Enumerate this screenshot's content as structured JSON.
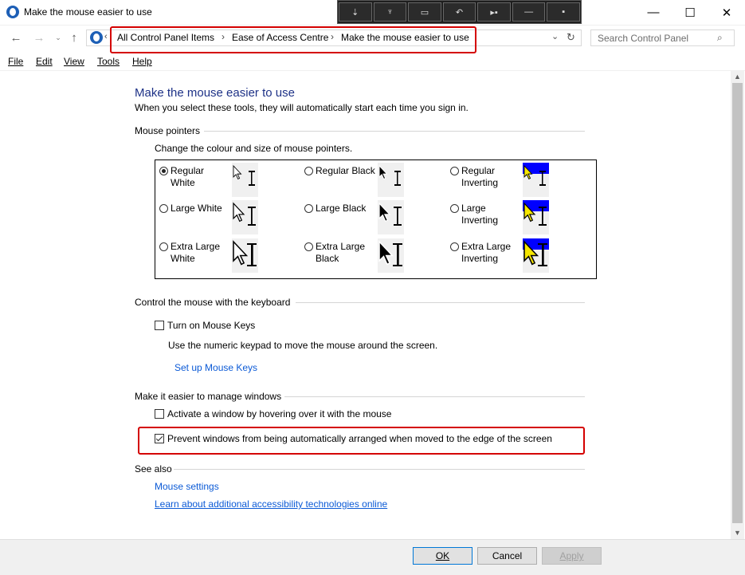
{
  "window": {
    "title": "Make the mouse easier to use",
    "minimize": "—",
    "maximize": "☐",
    "close": "✕"
  },
  "address": {
    "crumbs": [
      "All Control Panel Items",
      "Ease of Access Centre",
      "Make the mouse easier to use"
    ],
    "separator": "›",
    "search_placeholder": "Search Control Panel"
  },
  "menu": {
    "file": "File",
    "edit": "Edit",
    "view": "View",
    "tools": "Tools",
    "help": "Help"
  },
  "page": {
    "title": "Make the mouse easier to use",
    "subtitle": "When you select these tools, they will automatically start each time you sign in."
  },
  "pointers": {
    "section": "Mouse pointers",
    "caption": "Change the colour and size of mouse pointers.",
    "options": [
      {
        "line1": "Regular",
        "line2": "White",
        "selected": true,
        "scheme": "white",
        "size": 1
      },
      {
        "line1": "Regular Black",
        "line2": "",
        "selected": false,
        "scheme": "black",
        "size": 1
      },
      {
        "line1": "Regular",
        "line2": "Inverting",
        "selected": false,
        "scheme": "invert",
        "size": 1
      },
      {
        "line1": "Large White",
        "line2": "",
        "selected": false,
        "scheme": "white",
        "size": 2
      },
      {
        "line1": "Large Black",
        "line2": "",
        "selected": false,
        "scheme": "black",
        "size": 2
      },
      {
        "line1": "Large",
        "line2": "Inverting",
        "selected": false,
        "scheme": "invert",
        "size": 2
      },
      {
        "line1": "Extra Large",
        "line2": "White",
        "selected": false,
        "scheme": "white",
        "size": 3
      },
      {
        "line1": "Extra Large",
        "line2": "Black",
        "selected": false,
        "scheme": "black",
        "size": 3
      },
      {
        "line1": "Extra Large",
        "line2": "Inverting",
        "selected": false,
        "scheme": "invert",
        "size": 3
      }
    ]
  },
  "keyboard": {
    "section": "Control the mouse with the keyboard",
    "mouse_keys_label": "Turn on Mouse Keys",
    "mouse_keys_checked": false,
    "mouse_keys_desc": "Use the numeric keypad to move the mouse around the screen.",
    "setup_link": "Set up Mouse Keys"
  },
  "windows": {
    "section": "Make it easier to manage windows",
    "hover_label": "Activate a window by hovering over it with the mouse",
    "hover_checked": false,
    "prevent_label": "Prevent windows from being automatically arranged when moved to the edge of the screen",
    "prevent_checked": true
  },
  "see_also": {
    "section": "See also",
    "mouse_settings": "Mouse settings",
    "learn_more": "Learn about additional accessibility technologies online"
  },
  "buttons": {
    "ok": "OK",
    "cancel": "Cancel",
    "apply": "Apply"
  },
  "colors": {
    "title_blue": "#1e3287",
    "link_blue": "#0b5ad6",
    "highlight_red": "#d40000",
    "invert_blue": "#0000ff"
  }
}
